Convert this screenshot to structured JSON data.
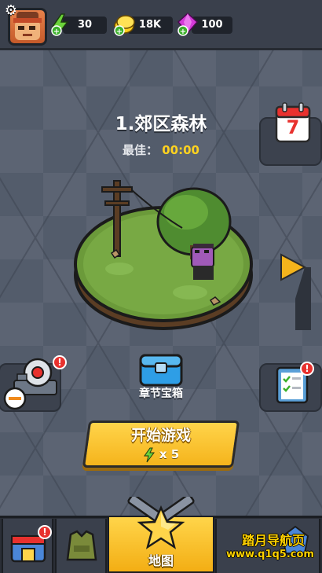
{
  "resources": {
    "energy": "30",
    "gold": "18K",
    "gems": "100"
  },
  "level": {
    "title": "1.郊区森林",
    "best_label": "最佳：",
    "best_time": "00:00"
  },
  "calendar_day": "7",
  "chest_label": "章节宝箱",
  "start": {
    "label": "开始游戏",
    "cost": "x 5"
  },
  "nav": {
    "map_label": "地图"
  },
  "watermark": {
    "title": "踏月导航页",
    "url": "www.q1q5.com"
  },
  "colors": {
    "accent": "#f5b41c",
    "energy": "#53c42a",
    "gold": "#ffcf1f",
    "gem": "#d43ad8",
    "alert": "#e8312e"
  }
}
